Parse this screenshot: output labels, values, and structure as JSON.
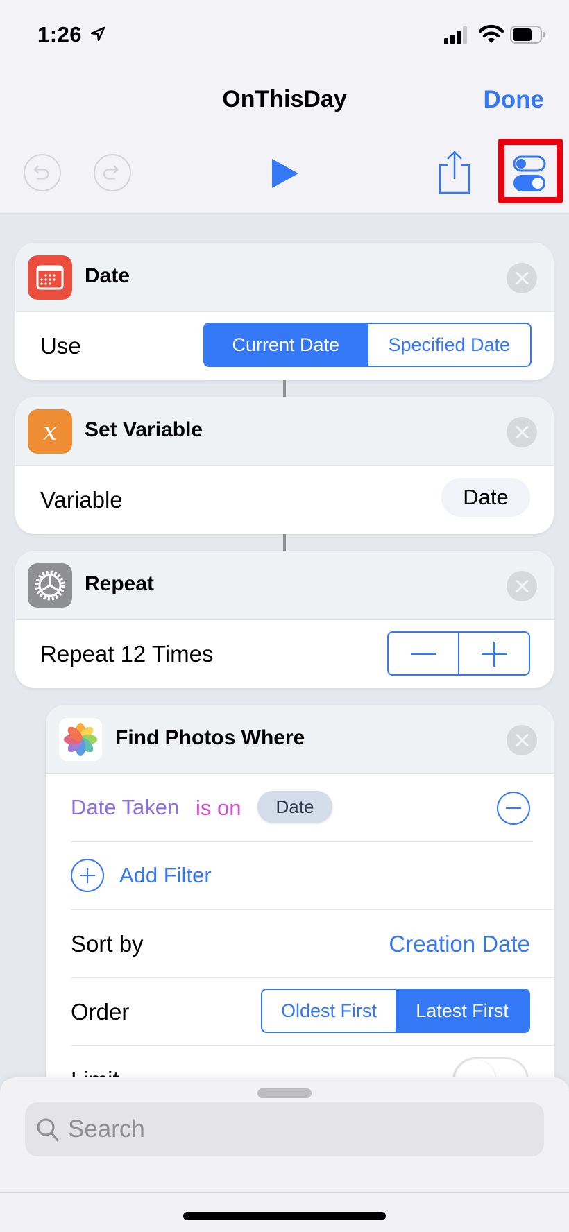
{
  "status_bar": {
    "time": "1:26",
    "location_icon": "location-arrow-icon",
    "signal_icon": "cellular-signal-icon",
    "wifi_icon": "wifi-icon",
    "battery_icon": "battery-icon"
  },
  "nav": {
    "title": "OnThisDay",
    "done_label": "Done"
  },
  "toolbar": {
    "undo_icon": "undo-icon",
    "redo_icon": "redo-icon",
    "play_icon": "play-icon",
    "share_icon": "share-icon",
    "settings_icon": "settings-toggles-icon",
    "highlight_color": "#e9000f"
  },
  "actions": [
    {
      "title": "Date",
      "icon": "calendar-icon",
      "icon_color": "#ec4e3d",
      "row_label": "Use",
      "segments": [
        {
          "label": "Current Date",
          "selected": true
        },
        {
          "label": "Specified Date",
          "selected": false
        }
      ]
    },
    {
      "title": "Set Variable",
      "icon": "variable-x-icon",
      "icon_color": "#ee8d34",
      "row_label": "Variable",
      "value": "Date"
    },
    {
      "title": "Repeat",
      "icon": "gear-icon",
      "icon_color": "#8e8e93",
      "row_label": "Repeat 12 Times",
      "count": 12
    },
    {
      "title": "Find Photos Where",
      "icon": "photos-icon",
      "filter": {
        "property": "Date Taken",
        "operator": "is on",
        "value": "Date"
      },
      "add_filter_label": "Add Filter",
      "sort_label": "Sort by",
      "sort_value": "Creation Date",
      "order_label": "Order",
      "order_segments": [
        {
          "label": "Oldest First",
          "selected": false
        },
        {
          "label": "Latest First",
          "selected": true
        }
      ],
      "limit_label": "Limit",
      "limit_enabled": false
    }
  ],
  "search": {
    "placeholder": "Search",
    "value": ""
  },
  "colors": {
    "accent": "#3478f6",
    "filter_property": "#8e6fe0",
    "filter_operator": "#d14fcf"
  }
}
